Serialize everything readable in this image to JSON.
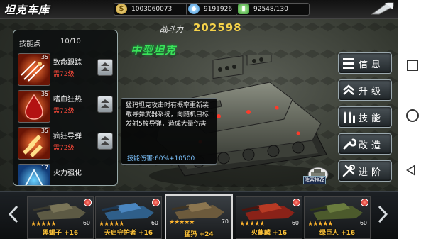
{
  "header": {
    "title": "坦克车库",
    "gold": "1003060073",
    "diamonds": "9191926",
    "fuel": "92548/130"
  },
  "power": {
    "label": "战斗力",
    "value": "202598"
  },
  "tank_class": "中型坦克",
  "skills": {
    "header_label": "技能点",
    "points": "10/10",
    "items": [
      {
        "name": "致命跟踪",
        "level": "35",
        "requirement": "需72级"
      },
      {
        "name": "嗜血狂热",
        "level": "35",
        "requirement": "需72级"
      },
      {
        "name": "疯狂导弹",
        "level": "35",
        "requirement": "需72级"
      },
      {
        "name": "火力强化",
        "level": "17",
        "requirement": ""
      }
    ]
  },
  "tooltip": {
    "description": "猛犸坦克攻击时有概率重新装载导弹武器系统，向随机目标发射5枚导弹，造成大量伤害",
    "damage": "技能伤害:60%+10500"
  },
  "menu": {
    "info": "信息",
    "upgrade": "升级",
    "skills": "技能",
    "modify": "改造",
    "advance": "进阶"
  },
  "formation_label": "阵容推荐",
  "roster": [
    {
      "name": "黑蝎子 +16",
      "stars": "★★★★★",
      "level": "60"
    },
    {
      "name": "天启守护者 +16",
      "stars": "★★★★★",
      "level": "60"
    },
    {
      "name": "猛犸 +24",
      "stars": "★★★★★",
      "level": "70"
    },
    {
      "name": "火麒麟 +16",
      "stars": "★★★★★",
      "level": "60"
    },
    {
      "name": "绿巨人 +16",
      "stars": "★★★★★",
      "level": "60"
    }
  ],
  "colors": {
    "accent_green": "#3be35a",
    "power_gold": "#f5d24a",
    "name_gold": "#ffc43a",
    "req_red": "#ff4a3a"
  }
}
